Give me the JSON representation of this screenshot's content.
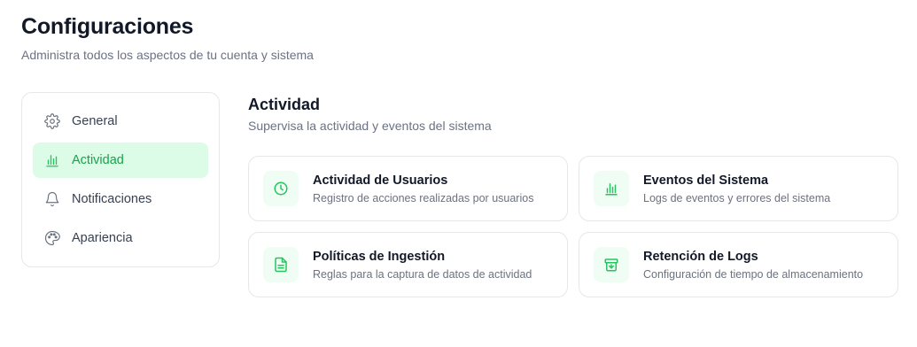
{
  "header": {
    "title": "Configuraciones",
    "subtitle": "Administra todos los aspectos de tu cuenta y sistema"
  },
  "sidebar": {
    "items": [
      {
        "label": "General",
        "icon": "gear-icon",
        "active": false
      },
      {
        "label": "Actividad",
        "icon": "bar-chart-icon",
        "active": true
      },
      {
        "label": "Notificaciones",
        "icon": "bell-icon",
        "active": false
      },
      {
        "label": "Apariencia",
        "icon": "palette-icon",
        "active": false
      }
    ]
  },
  "section": {
    "title": "Actividad",
    "subtitle": "Supervisa la actividad y eventos del sistema"
  },
  "cards": [
    {
      "title": "Actividad de Usuarios",
      "description": "Registro de acciones realizadas por usuarios",
      "icon": "clock-icon"
    },
    {
      "title": "Eventos del Sistema",
      "description": "Logs de eventos y errores del sistema",
      "icon": "bar-chart-icon"
    },
    {
      "title": "Políticas de Ingestión",
      "description": "Reglas para la captura de datos de actividad",
      "icon": "document-icon"
    },
    {
      "title": "Retención de Logs",
      "description": "Configuración de tiempo de almacenamiento",
      "icon": "archive-icon"
    }
  ],
  "colors": {
    "accent": "#22c55e",
    "accent_bg": "#dcfce7",
    "icon_bg": "#f0fdf4",
    "border": "#e5e7eb",
    "muted_text": "#6b7280"
  }
}
